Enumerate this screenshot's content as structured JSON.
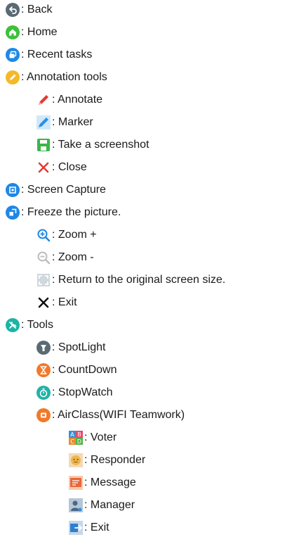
{
  "items": {
    "back": ": Back",
    "home": ": Home",
    "recent": ": Recent tasks",
    "annotation_tools": ": Annotation tools",
    "annotate": ": Annotate",
    "marker": ": Marker",
    "take_screenshot": ": Take a screenshot",
    "close": ": Close",
    "screen_capture": ": Screen Capture",
    "freeze": ": Freeze the picture.",
    "zoom_in": ": Zoom +",
    "zoom_out": ": Zoom -",
    "return_original": ": Return to the original screen size.",
    "exit": ": Exit",
    "tools": ": Tools",
    "spotlight": ": SpotLight",
    "countdown": ": CountDown",
    "stopwatch": ": StopWatch",
    "airclass": ": AirClass(WIFI Teamwork)",
    "voter": ": Voter",
    "responder": ": Responder",
    "message": ": Message",
    "manager": ": Manager",
    "airclass_exit": ": Exit"
  },
  "icons": {
    "back": "back-icon",
    "home": "home-icon",
    "recent": "recent-tasks-icon",
    "annotation_tools": "pencil-icon",
    "annotate": "red-pen-icon",
    "marker": "marker-icon",
    "take_screenshot": "save-icon",
    "close": "close-icon",
    "screen_capture": "screen-capture-icon",
    "freeze": "freeze-icon",
    "zoom_in": "zoom-in-icon",
    "zoom_out": "zoom-out-icon",
    "return_original": "original-size-icon",
    "exit": "exit-x-icon",
    "tools": "tools-icon",
    "spotlight": "spotlight-icon",
    "countdown": "hourglass-icon",
    "stopwatch": "stopwatch-icon",
    "airclass": "airclass-icon",
    "voter": "voter-icon",
    "responder": "responder-icon",
    "message": "message-icon",
    "manager": "manager-icon",
    "airclass_exit": "exit-door-icon"
  },
  "colors": {
    "gray": "#5a6a73",
    "green": "#3cc13b",
    "blue": "#1e88e5",
    "yellow": "#f4b928",
    "red": "#e53935",
    "teal": "#1fb3a6",
    "orange": "#f07a2b",
    "lightgray": "#bdbdbd"
  }
}
